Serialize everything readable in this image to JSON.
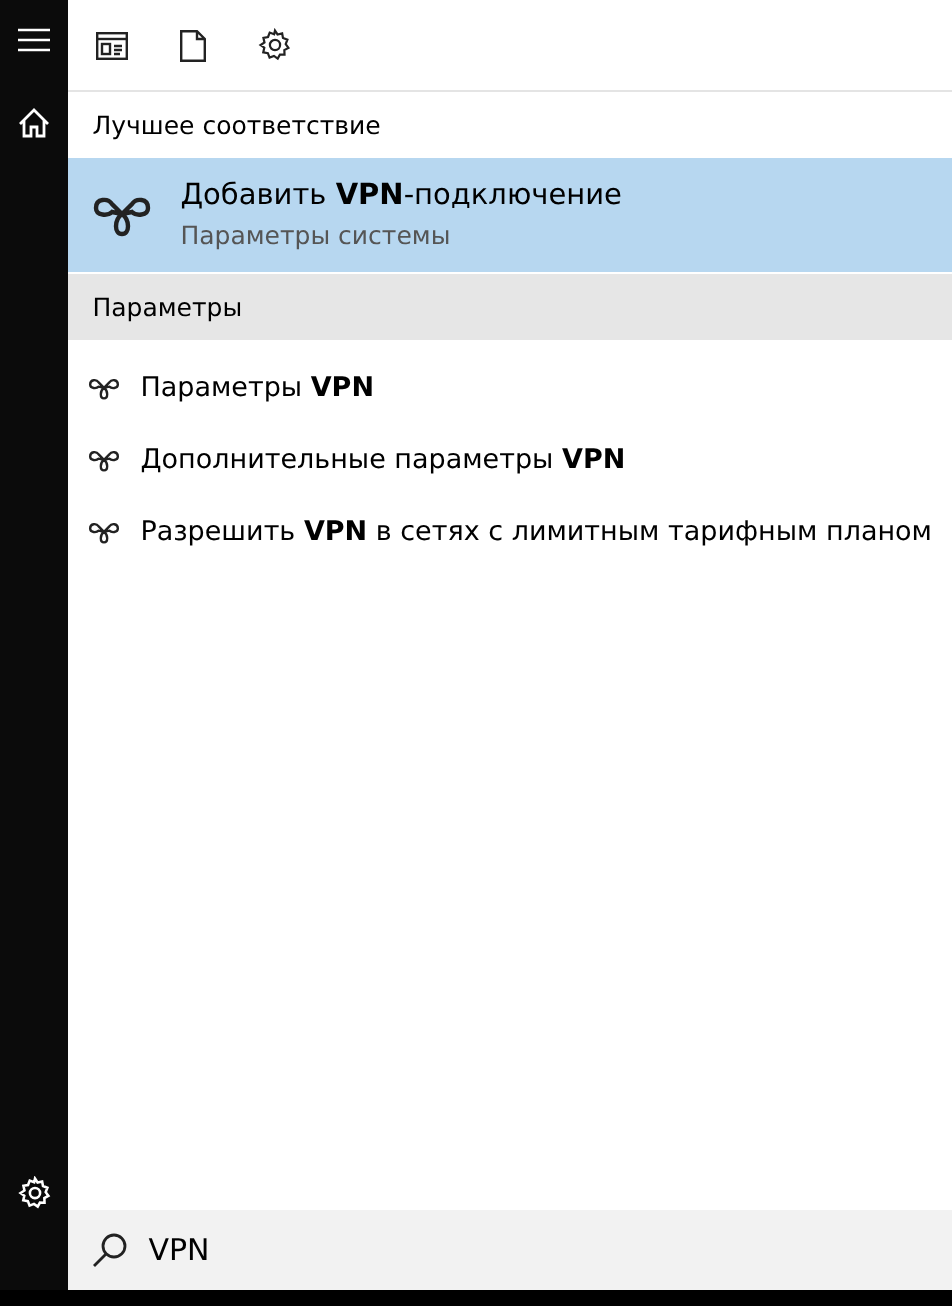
{
  "best_match": {
    "heading": "Лучшее соответствие",
    "item": {
      "title": "Добавить **VPN**-подключение",
      "subtitle": "Параметры системы",
      "selected": true
    }
  },
  "settings": {
    "heading": "Параметры",
    "items": [
      {
        "title": "Параметры **VPN**",
        "selected": false
      },
      {
        "title": "Дополнительные параметры **VPN**",
        "selected": false
      },
      {
        "title": "Разрешить **VPN** в сетях с лимитным тарифным планом",
        "selected": false
      }
    ]
  },
  "search": {
    "value": "VPN"
  }
}
